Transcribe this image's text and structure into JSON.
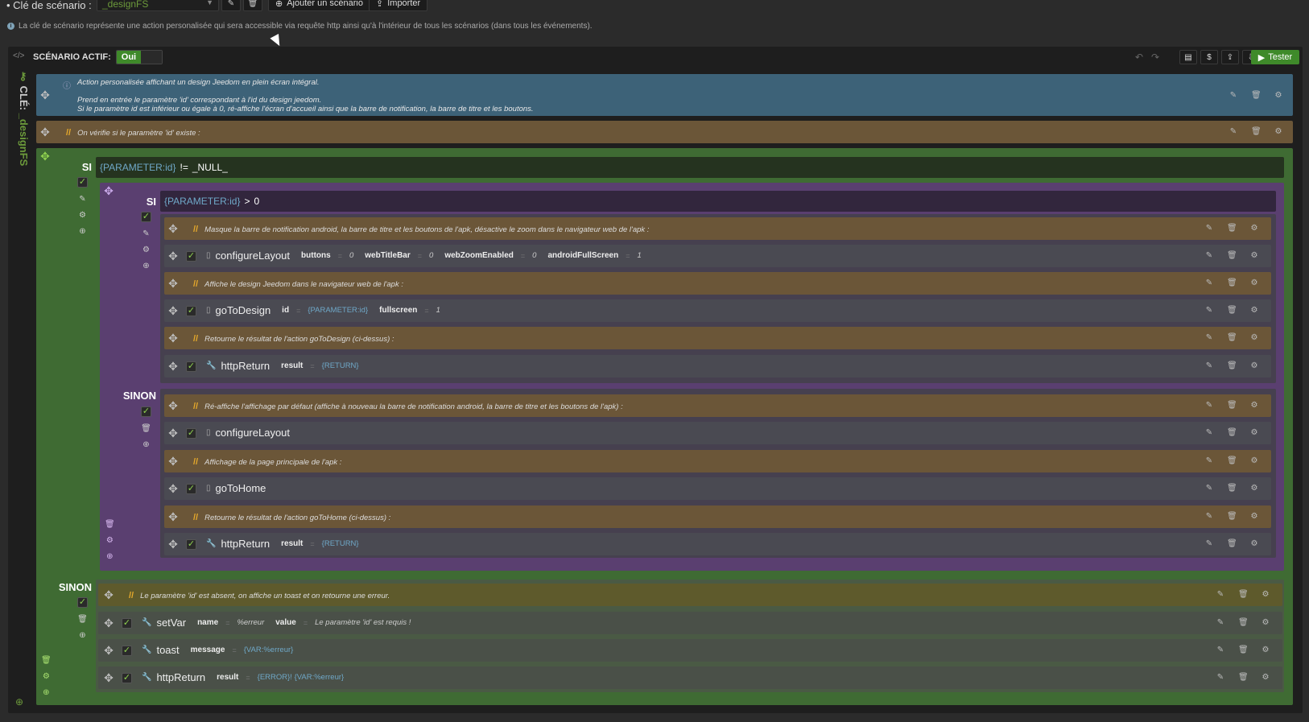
{
  "top": {
    "key_label": "• Clé de scénario :",
    "key_value": "_designFS",
    "add_label": "Ajouter un scénario",
    "import_label": "Importer",
    "info_text": "La clé de scénario représente une action personalisée qui sera accessible via requête http ainsi qu'à l'intérieur de tous les scénarios (dans tous les événements)."
  },
  "sidebar": {
    "key_prefix": "CLÉ:",
    "key_name": "_designFS"
  },
  "header": {
    "active_label": "SCÉNARIO ACTIF:",
    "active_value": "Oui",
    "test_label": "Tester"
  },
  "description": {
    "line1": "Action personalisée affichant un design Jeedom en plein écran intégral.",
    "line2": "Prend en entrée le paramètre 'id' correspondant à l'id du design jeedom.",
    "line3": "Si le paramètre id est inférieur ou égale à 0, ré-affiche l'écran d'accueil ainsi que la barre de notification, la barre de titre et les boutons."
  },
  "comment_check": "On vérifie si le paramètre 'id' existe :",
  "outer_if": {
    "label": "SI",
    "cond_var": "{PARAMETER:id}",
    "cond_op": "!=",
    "cond_val": "_NULL_",
    "else_label": "SINON"
  },
  "inner_if": {
    "label": "SI",
    "cond_var": "{PARAMETER:id}",
    "cond_op": ">",
    "cond_val": "0",
    "else_label": "SINON"
  },
  "inner_then": {
    "c1": "Masque la barre de notification android, la barre de titre et les boutons de l'apk, désactive le zoom dans le navigateur web de l'apk :",
    "a1": {
      "name": "configureLayout",
      "k1": "buttons",
      "v1": "0",
      "k2": "webTitleBar",
      "v2": "0",
      "k3": "webZoomEnabled",
      "v3": "0",
      "k4": "androidFullScreen",
      "v4": "1"
    },
    "c2": "Affiche le design Jeedom dans le navigateur web de l'apk :",
    "a2": {
      "name": "goToDesign",
      "k1": "id",
      "v1": "{PARAMETER:id}",
      "k2": "fullscreen",
      "v2": "1"
    },
    "c3": "Retourne le résultat de l'action goToDesign (ci-dessus) :",
    "a3": {
      "name": "httpReturn",
      "k1": "result",
      "v1": "{RETURN}"
    }
  },
  "inner_else": {
    "c1": "Ré-affiche l'affichage par défaut (affiche à nouveau la barre de notification android, la barre de titre et les boutons de l'apk) :",
    "a1": {
      "name": "configureLayout"
    },
    "c2": "Affichage de la page principale de l'apk :",
    "a2": {
      "name": "goToHome"
    },
    "c3": "Retourne le résultat de l'action goToHome (ci-dessus) :",
    "a3": {
      "name": "httpReturn",
      "k1": "result",
      "v1": "{RETURN}"
    }
  },
  "outer_else": {
    "c1": "Le paramètre 'id' est absent, on affiche un toast et on retourne une erreur.",
    "a1": {
      "name": "setVar",
      "k1": "name",
      "v1": "%erreur",
      "k2": "value",
      "v2": "Le paramètre 'id' est requis !"
    },
    "a2": {
      "name": "toast",
      "k1": "message",
      "v1": "{VAR:%erreur}"
    },
    "a3": {
      "name": "httpReturn",
      "k1": "result",
      "v1": "{ERROR}! {VAR:%erreur}"
    }
  },
  "colors": {
    "description_bg": "#3d6278",
    "comment_bg": "#6b5638",
    "outer_if_bg": "#3f6b33",
    "inner_if_bg": "#5a3f70",
    "action_bg": "#4a4a52",
    "comment_green_bg": "#5e5a2c"
  },
  "icons": {
    "drag": "arrows-move-icon",
    "edit": "pencil-icon",
    "delete": "trash-icon",
    "settings": "gear-icon",
    "add": "plus-circle-icon",
    "check": "check-icon"
  }
}
